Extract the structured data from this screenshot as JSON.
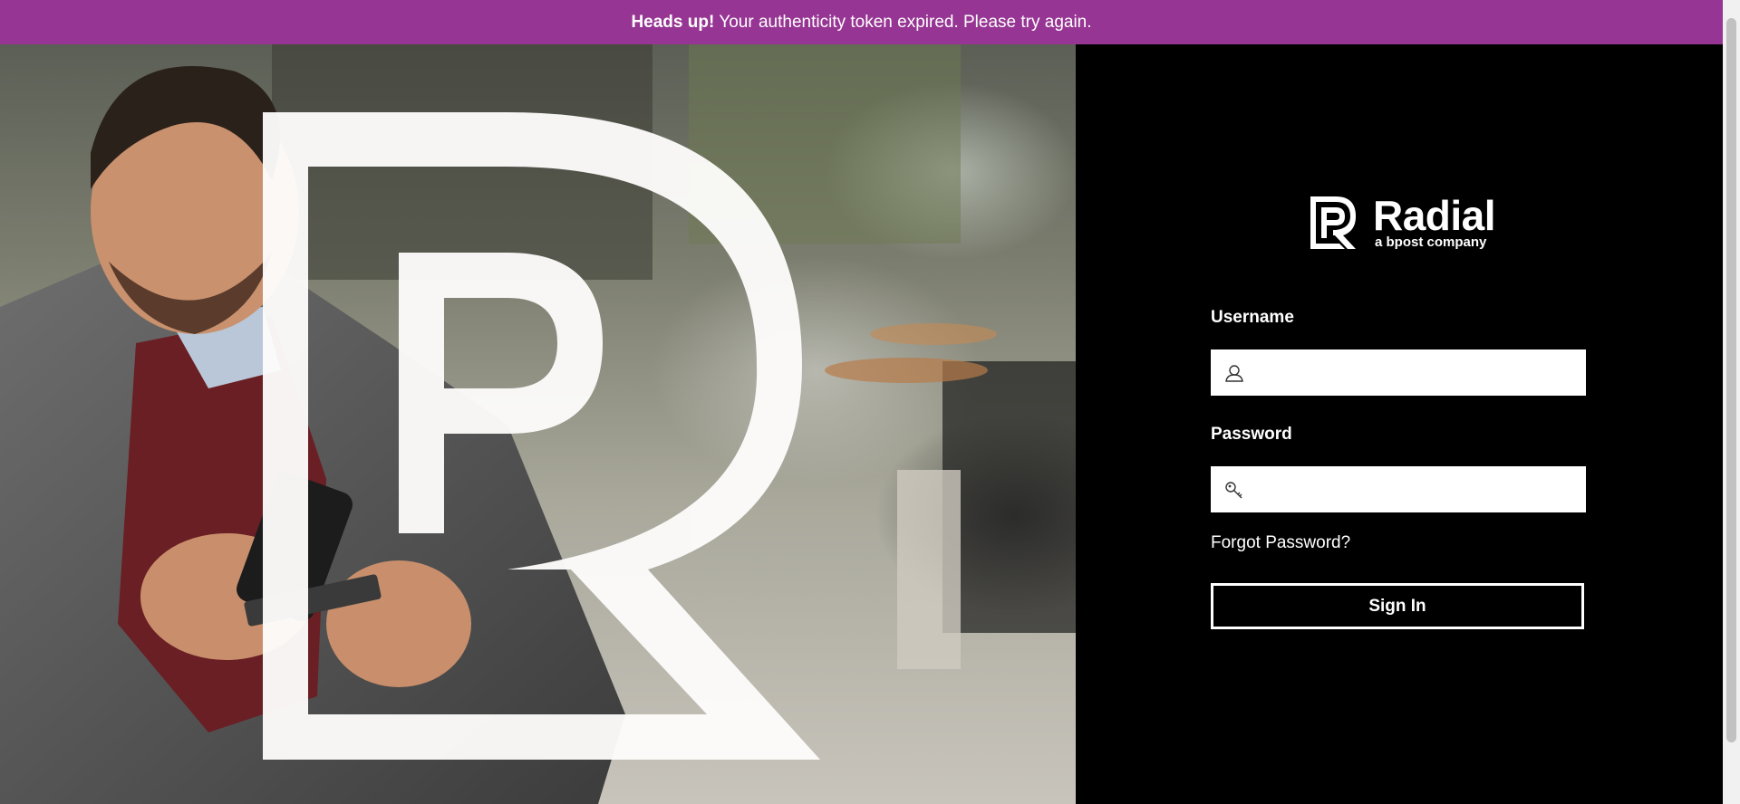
{
  "banner": {
    "strong": "Heads up!",
    "message": "Your authenticity token expired. Please try again.",
    "color": "#963593"
  },
  "hero": {
    "image": "man-smiling-with-phone-and-credit-card-photo",
    "overlay_icon": "radial-r-outline-icon"
  },
  "logo": {
    "brand": "Radial",
    "tagline": "a bpost company",
    "icon": "radial-r-logo-icon"
  },
  "form": {
    "username_label": "Username",
    "username_value": "",
    "username_icon": "user-icon",
    "password_label": "Password",
    "password_value": "",
    "password_icon": "key-icon",
    "forgot_label": "Forgot Password?",
    "signin_label": "Sign In"
  }
}
